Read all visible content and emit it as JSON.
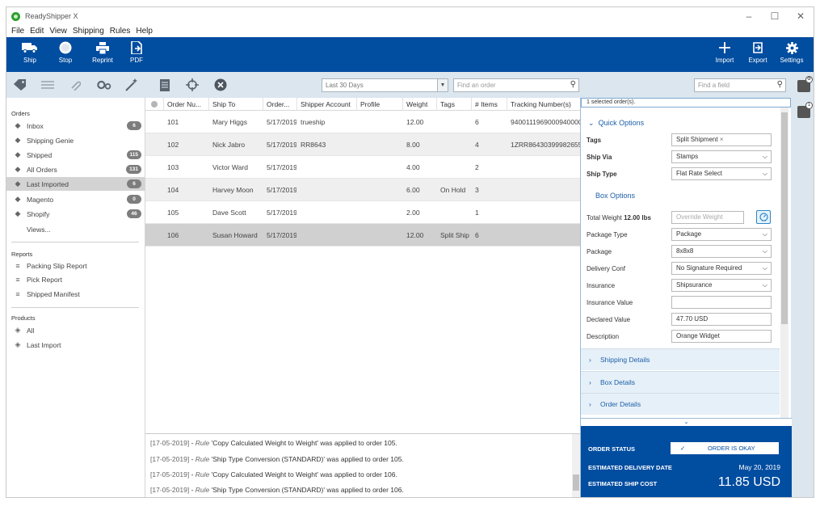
{
  "window": {
    "title": "ReadyShipper X",
    "controls": [
      "–",
      "☐",
      "✕"
    ]
  },
  "menu": [
    "File",
    "Edit",
    "View",
    "Shipping",
    "Rules",
    "Help"
  ],
  "toolbar": {
    "left": [
      {
        "label": "Ship",
        "icon": "truck-icon"
      },
      {
        "label": "Stop",
        "icon": "stop-icon"
      },
      {
        "label": "Reprint",
        "icon": "printer-icon"
      },
      {
        "label": "PDF",
        "icon": "pdf-icon"
      }
    ],
    "right": [
      {
        "label": "Import",
        "icon": "plus-icon"
      },
      {
        "label": "Export",
        "icon": "export-icon"
      },
      {
        "label": "Settings",
        "icon": "gear-icon"
      }
    ]
  },
  "filters": {
    "date_range": "Last 30 Days",
    "order_search_placeholder": "Find an order",
    "field_search_placeholder": "Find a field"
  },
  "sidebar": {
    "orders_title": "Orders",
    "orders": [
      {
        "label": "Inbox",
        "badge": "6",
        "active": false
      },
      {
        "label": "Shipping Genie",
        "badge": "",
        "active": false
      },
      {
        "label": "Shipped",
        "badge": "115",
        "active": false
      },
      {
        "label": "All Orders",
        "badge": "131",
        "active": false
      },
      {
        "label": "Last Imported",
        "badge": "6",
        "active": true
      },
      {
        "label": "Magento",
        "badge": "0",
        "active": false
      },
      {
        "label": "Shopify",
        "badge": "46",
        "active": false
      }
    ],
    "views_label": "Views...",
    "reports_title": "Reports",
    "reports": [
      "Packing Slip Report",
      "Pick Report",
      "Shipped Manifest"
    ],
    "products_title": "Products",
    "products": [
      "All",
      "Last Import"
    ]
  },
  "grid": {
    "columns": [
      "Order Nu...",
      "Ship To",
      "Order...",
      "Shipper Account",
      "Profile",
      "Weight",
      "Tags",
      "# Items",
      "Tracking Number(s)"
    ],
    "rows": [
      {
        "order": "101",
        "ship_to": "Mary Higgs",
        "date": "5/17/2019",
        "account": "trueship",
        "profile": "",
        "weight": "12.00",
        "tags": "",
        "items": "6",
        "tracking": "9400111969000940000"
      },
      {
        "order": "102",
        "ship_to": "Nick Jabro",
        "date": "5/17/2019",
        "account": "RR8643",
        "profile": "",
        "weight": "8.00",
        "tags": "",
        "items": "4",
        "tracking": "1ZRR86430399982655"
      },
      {
        "order": "103",
        "ship_to": "Victor Ward",
        "date": "5/17/2019",
        "account": "",
        "profile": "",
        "weight": "4.00",
        "tags": "",
        "items": "2",
        "tracking": ""
      },
      {
        "order": "104",
        "ship_to": "Harvey Moon",
        "date": "5/17/2019",
        "account": "",
        "profile": "",
        "weight": "6.00",
        "tags": "On Hold",
        "items": "3",
        "tracking": ""
      },
      {
        "order": "105",
        "ship_to": "Dave Scott",
        "date": "5/17/2019",
        "account": "",
        "profile": "",
        "weight": "2.00",
        "tags": "",
        "items": "1",
        "tracking": ""
      },
      {
        "order": "106",
        "ship_to": "Susan Howard",
        "date": "5/17/2019",
        "account": "",
        "profile": "",
        "weight": "12.00",
        "tags": "Split Ship",
        "items": "6",
        "tracking": ""
      }
    ]
  },
  "log": [
    {
      "ts": "[17-05-2019]",
      "rule": "Rule",
      "text": " 'Copy Calculated Weight to Weight' was applied to order 105."
    },
    {
      "ts": "[17-05-2019]",
      "rule": "Rule",
      "text": " 'Ship Type Conversion (STANDARD)' was applied to order 105."
    },
    {
      "ts": "[17-05-2019]",
      "rule": "Rule",
      "text": " 'Copy Calculated Weight to Weight' was applied to order 106."
    },
    {
      "ts": "[17-05-2019]",
      "rule": "Rule",
      "text": " 'Ship Type Conversion (STANDARD)' was applied to order 106."
    }
  ],
  "panel": {
    "selected_text": "1 selected order(s).",
    "quick_options_label": "Quick Options",
    "tags_label": "Tags",
    "tags_value": "Split Shipment",
    "ship_via_label": "Ship Via",
    "ship_via_value": "Stamps",
    "ship_type_label": "Ship Type",
    "ship_type_value": "Flat Rate Select",
    "box_options_label": "Box Options",
    "total_weight_label": "Total Weight",
    "total_weight_value": "12.00 lbs",
    "override_placeholder": "Override Weight",
    "package_type_label": "Package Type",
    "package_type_value": "Package",
    "package_label": "Package",
    "package_value": "8x8x8",
    "delivery_conf_label": "Delivery Conf",
    "delivery_conf_value": "No Signature Required",
    "insurance_label": "Insurance",
    "insurance_value": "Shipsurance",
    "insurance_value_label": "Insurance Value",
    "insurance_value_value": "",
    "declared_value_label": "Declared Value",
    "declared_value_value": "47.70 USD",
    "description_label": "Description",
    "description_value": "Orange Widget",
    "accordions": [
      "Shipping Details",
      "Box Details",
      "Order Details"
    ]
  },
  "status": {
    "order_status_label": "ORDER STATUS",
    "order_status_value": "ORDER IS OKAY",
    "delivery_label": "ESTIMATED DELIVERY DATE",
    "delivery_value": "May 20, 2019",
    "cost_label": "ESTIMATED SHIP COST",
    "cost_value": "11.85 USD"
  },
  "colors": {
    "brand_blue": "#014da0",
    "link_blue": "#1c5fa8",
    "badge_gray": "#7d7d7d"
  }
}
